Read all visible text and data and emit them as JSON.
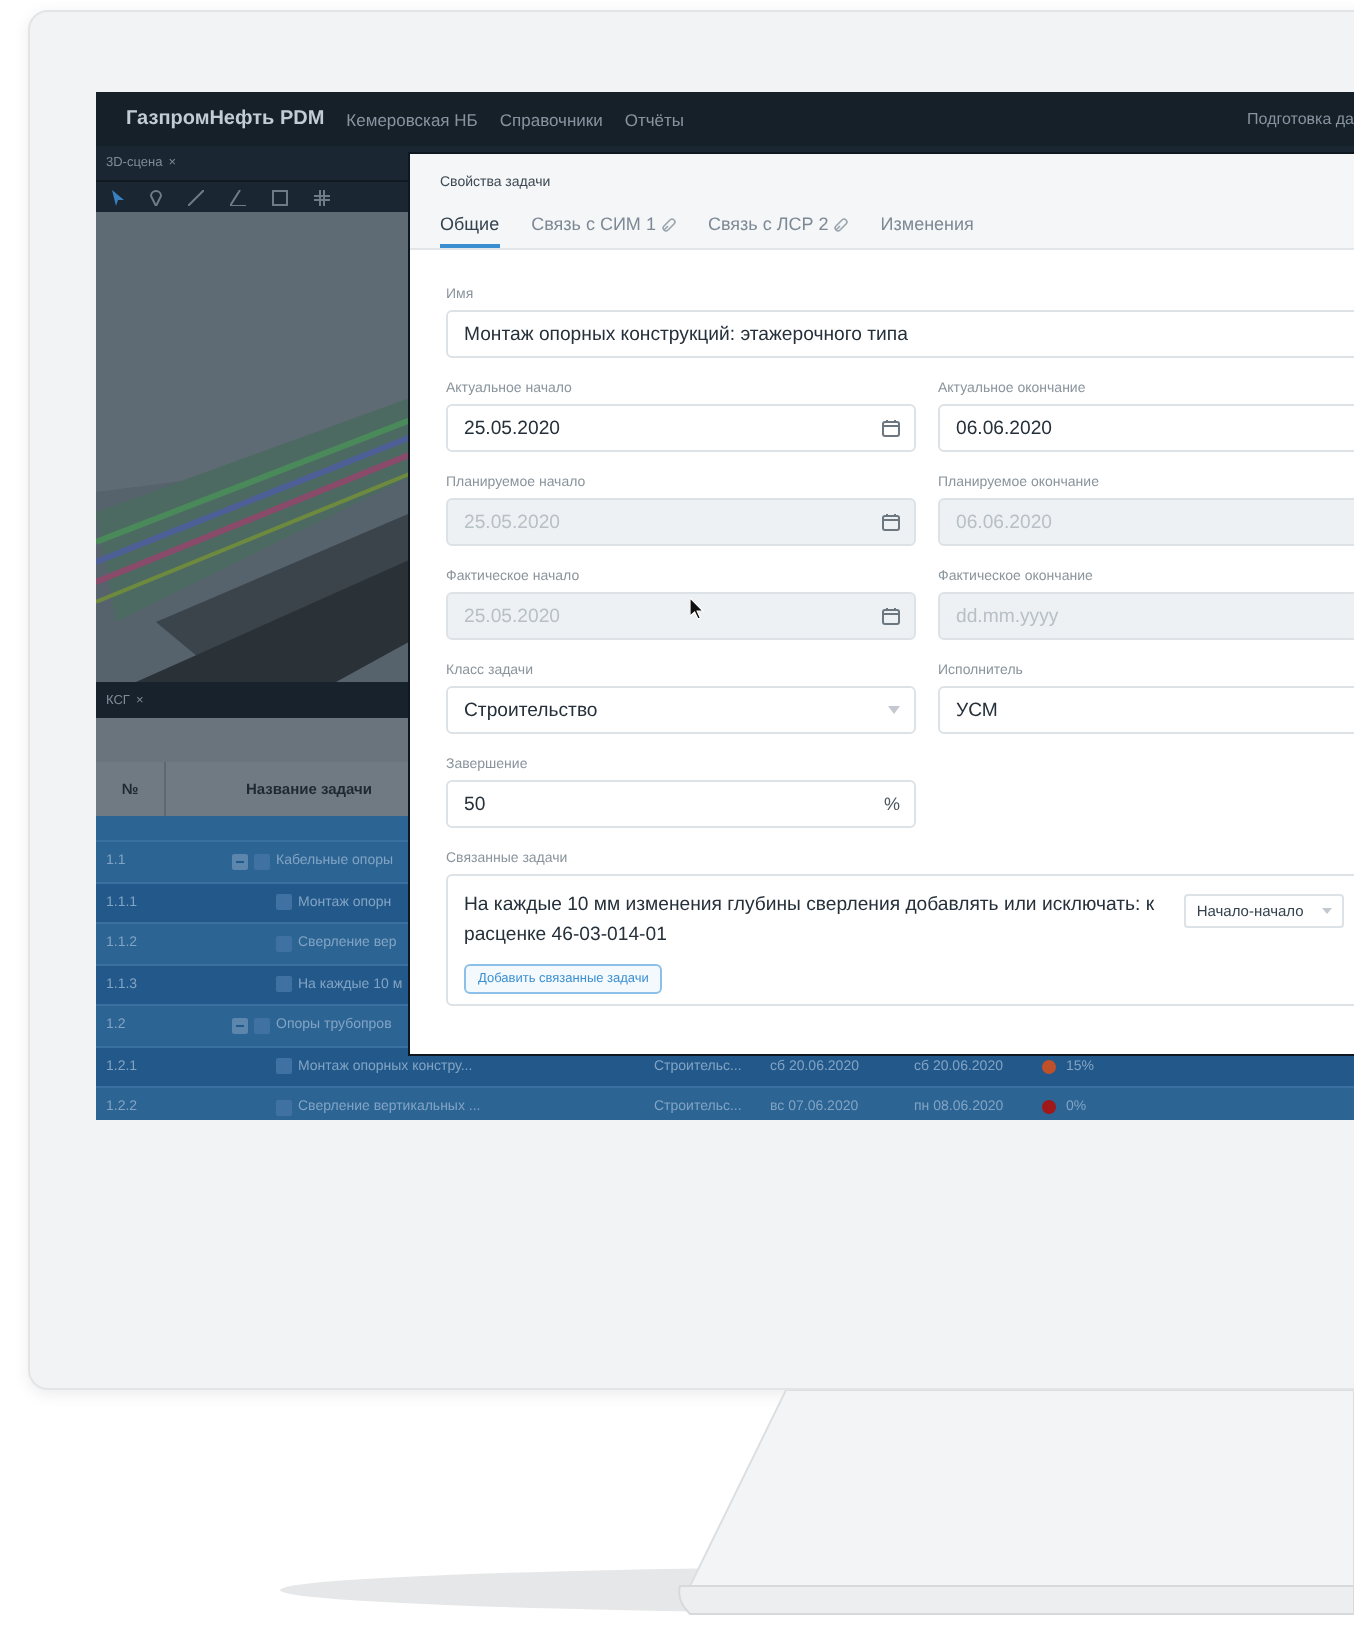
{
  "app": {
    "brand": "ГазпромНефть PDM",
    "project": "Кемеровская НБ",
    "menu": [
      {
        "label": "Справочники"
      },
      {
        "label": "Отчёты"
      }
    ],
    "user_area": "Подготовка да"
  },
  "scene_panel": {
    "tab": "3D-сцена",
    "close": "×"
  },
  "schedule_panel": {
    "tab": "КСГ",
    "close": "×"
  },
  "table": {
    "columns": [
      "№",
      "Название задачи"
    ],
    "rows": [
      {
        "number": "1.1",
        "kind": "group",
        "expanded": true,
        "name": "Кабельные опоры"
      },
      {
        "number": "1.1.1",
        "kind": "task",
        "name": "Монтаж опорн"
      },
      {
        "number": "1.1.2",
        "kind": "task",
        "name": "Сверление вер"
      },
      {
        "number": "1.1.3",
        "kind": "task",
        "name": "На каждые 10 м"
      },
      {
        "number": "1.2",
        "kind": "group",
        "expanded": true,
        "name": "Опоры трубопров"
      },
      {
        "number": "1.2.1",
        "kind": "task",
        "name": "Монтаж опорных констру...",
        "class": "Строительс...",
        "start": "сб 20.06.2020",
        "end": "сб 20.06.2020",
        "color": "#c0502a",
        "progress": "15%"
      },
      {
        "number": "1.2.2",
        "kind": "task",
        "name": "Сверление вертикальных ...",
        "class": "Строительс...",
        "start": "вс 07.06.2020",
        "end": "пн 08.06.2020",
        "color": "#a01818",
        "progress": "0%"
      }
    ]
  },
  "dialog": {
    "title": "Свойства задачи",
    "tabs": [
      {
        "label": "Общие",
        "selected": true
      },
      {
        "label": "Связь с СИМ",
        "count": "1",
        "selected": false
      },
      {
        "label": "Связь с ЛСР",
        "count": "2",
        "selected": false
      },
      {
        "label": "Изменения",
        "selected": false
      }
    ],
    "name_field": {
      "label": "Имя",
      "value": "Монтаж опорных конструкций: этажерочного типа"
    },
    "rows": [
      [
        {
          "label": "Актуальное начало",
          "kind": "date",
          "value": "25.05.2020",
          "disabled": false
        },
        {
          "label": "Актуальное окончание",
          "kind": "text",
          "value": "06.06.2020",
          "disabled": false
        }
      ],
      [
        {
          "label": "Планируемое начало",
          "kind": "date",
          "value": "25.05.2020",
          "disabled": true
        },
        {
          "label": "Планируемое окончание",
          "kind": "text",
          "value": "06.06.2020",
          "disabled": true
        }
      ],
      [
        {
          "label": "Фактическое начало",
          "kind": "date",
          "value": "25.05.2020",
          "disabled": true
        },
        {
          "label": "Фактическое окончание",
          "kind": "text",
          "placeholder": "dd.mm.yyyy",
          "disabled": true
        }
      ],
      [
        {
          "label": "Класс задачи",
          "kind": "select",
          "value": "Строительство",
          "disabled": false
        },
        {
          "label": "Исполнитель",
          "kind": "text",
          "value": "УСМ",
          "disabled": false
        }
      ],
      [
        {
          "label": "Завершение",
          "kind": "percent",
          "value": "50",
          "suffix": "%",
          "disabled": false
        }
      ]
    ],
    "related": {
      "label": "Связанные задачи",
      "items": [
        {
          "text": "На каждые 10 мм изменения глубины сверления добавлять или исключать: к расценке 46-03-014-01",
          "link_type": "Начало-начало"
        }
      ],
      "add_button": "Добавить связанные задачи"
    }
  }
}
